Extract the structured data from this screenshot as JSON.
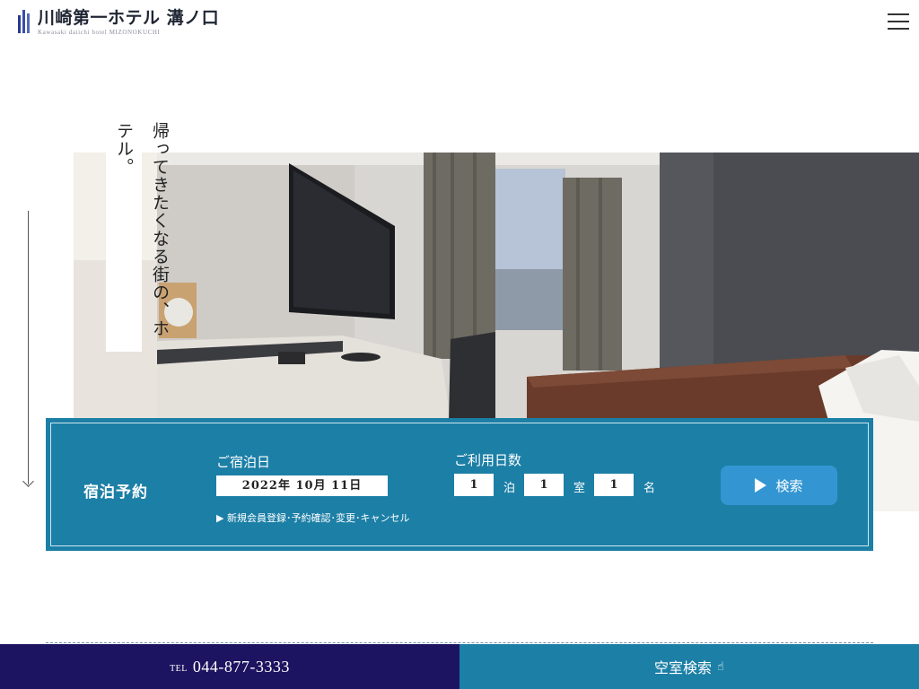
{
  "header": {
    "logo_title": "川崎第一ホテル 溝ノ口",
    "logo_sub": "Kawasaki daiichi hotel MIZONOKUCHI"
  },
  "hero": {
    "tagline": "帰ってきたくなる街の、ホテル。"
  },
  "booking": {
    "title": "宿泊予約",
    "stay_label": "ご宿泊日",
    "date_value": "2022年 10月 11日",
    "member_link": "▶ 新規会員登録･予約確認･変更･キャンセル",
    "days_label": "ご利用日数",
    "nights_value": "1",
    "nights_unit": "泊",
    "rooms_value": "1",
    "rooms_unit": "室",
    "guests_value": "1",
    "guests_unit": "名",
    "search_label": "検索"
  },
  "bottom_bar": {
    "tel_label": "TEL",
    "tel_number": "044-877-3333",
    "search_label": "空室検索",
    "search_icon_glyph": "☝"
  },
  "colors": {
    "booking_bg": "#1c7fa6",
    "search_btn": "#3396d3",
    "tel_bar": "#1c1460",
    "logo_accent": "#2b3a8f"
  }
}
